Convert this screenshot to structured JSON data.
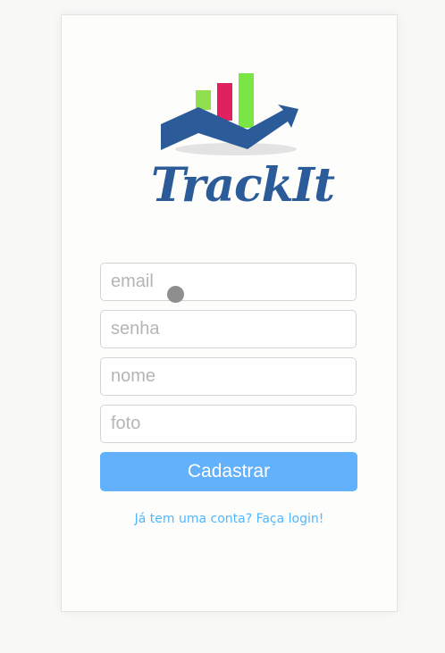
{
  "logo": {
    "text": "TrackIt",
    "icon": "bar-chart-growth-icon",
    "colors": {
      "bar_light_green": "#8fe04f",
      "bar_magenta": "#e0205f",
      "bar_green": "#79e645",
      "arrow_blue": "#2b5c99",
      "shadow": "#e5e5e5"
    }
  },
  "form": {
    "email_placeholder": "email",
    "password_placeholder": "senha",
    "name_placeholder": "nome",
    "photo_placeholder": "foto",
    "submit_label": "Cadastrar"
  },
  "login_link": "Já tem uma conta? Faça login!",
  "colors": {
    "page_background": "#f8f8f7",
    "button": "#62b1fa",
    "link": "#52b6ff"
  }
}
